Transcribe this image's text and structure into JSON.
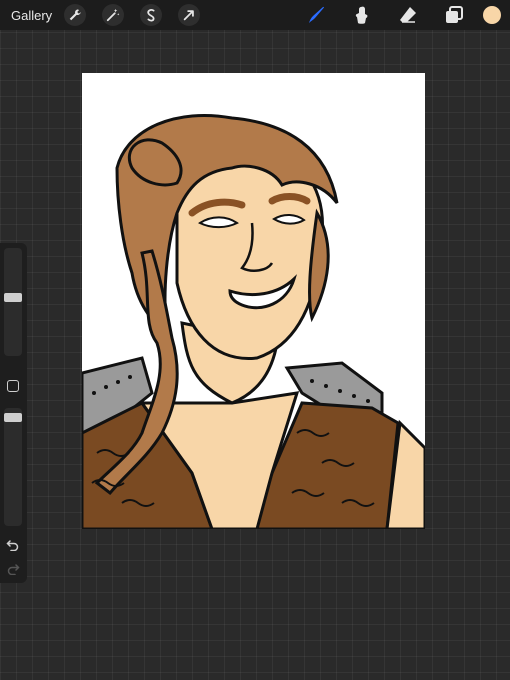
{
  "topbar": {
    "gallery_label": "Gallery",
    "actions": [
      {
        "name": "wrench-icon"
      },
      {
        "name": "adjustments-wand-icon"
      },
      {
        "name": "selection-icon"
      },
      {
        "name": "transform-arrow-icon"
      }
    ],
    "tools": [
      {
        "name": "brush-icon",
        "active": true
      },
      {
        "name": "smudge-icon",
        "active": false
      },
      {
        "name": "eraser-icon",
        "active": false
      },
      {
        "name": "layers-icon",
        "active": false
      }
    ],
    "current_color": "#f8d6a8"
  },
  "sidebar": {
    "brush_size_level": 0.55,
    "opacity_level": 0.95,
    "undo_icon": "undo-arrow-icon",
    "redo_icon": "redo-arrow-icon"
  },
  "canvas": {
    "subject": "illustrated-portrait",
    "colors": {
      "hair": "#b27a4a",
      "skin": "#f8d6a8",
      "vest": "#7a4a22",
      "armor": "#9a9a9a",
      "eyebrows": "#8a5225"
    }
  },
  "theme": {
    "accent": "#2b6cff"
  }
}
